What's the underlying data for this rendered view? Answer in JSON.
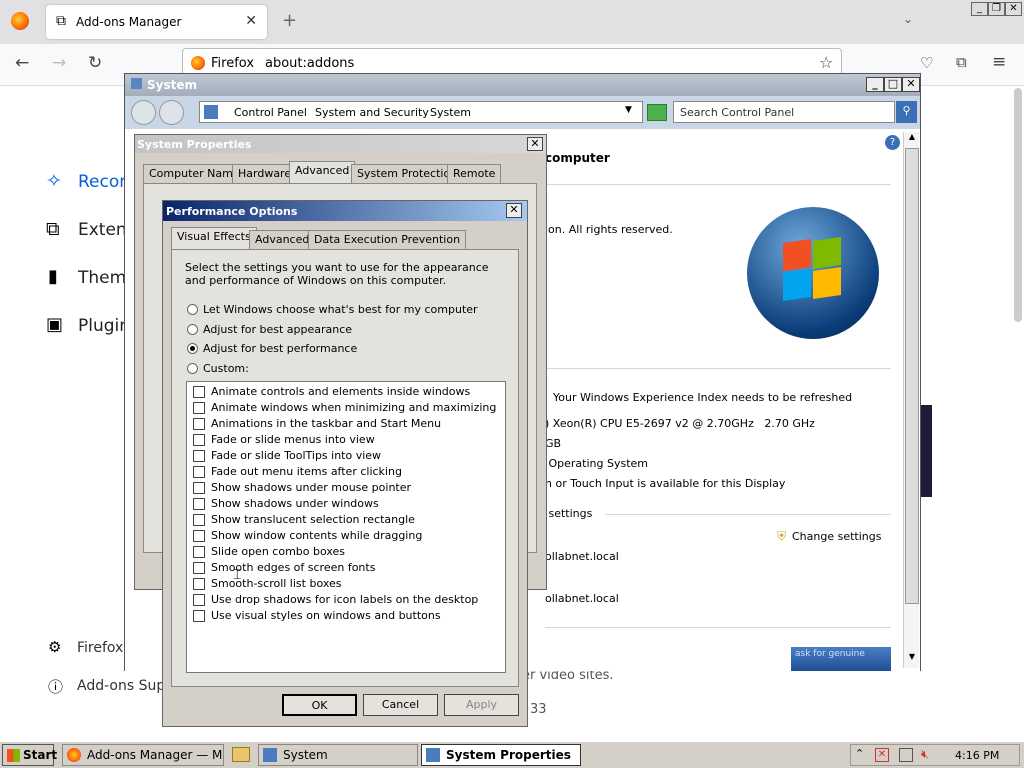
{
  "firefox": {
    "tab_title": "Add-ons Manager",
    "url_identity": "Firefox",
    "url": "about:addons"
  },
  "addons_page": {
    "sidebar": [
      {
        "label": "Recom",
        "icon": "sparkle-icon"
      },
      {
        "label": "Extens",
        "icon": "puzzle-icon"
      },
      {
        "label": "Theme",
        "icon": "brush-icon"
      },
      {
        "label": "Plugin",
        "icon": "plugin-icon"
      }
    ],
    "footer": [
      "Firefox",
      "Add-ons Supp"
    ],
    "bg_text": [
      "er video sites.",
      "33"
    ]
  },
  "system_window": {
    "title": "System",
    "breadcrumb": [
      "Control Panel",
      "System and Security",
      "System"
    ],
    "search_placeholder": "Search Control Panel",
    "heading_fragment": "computer",
    "rights": "ion.  All rights reserved.",
    "wei_text": "Your Windows Experience Index needs to be refreshed",
    "cpu": ") Xeon(R) CPU E5-2697 v2 @ 2.70GHz   2.70 GHz",
    "ram": "GB",
    "os_type": " Operating System",
    "pen": "n or Touch Input is available for this Display",
    "settings_section": " settings",
    "change_settings": "Change settings",
    "domain1": "ollabnet.local",
    "domain2": "ollabnet.local",
    "genuine": "ask for genuine"
  },
  "system_properties": {
    "title": "System Properties",
    "tabs": [
      "Computer Name",
      "Hardware",
      "Advanced",
      "System Protection",
      "Remote"
    ],
    "active_tab": "Advanced"
  },
  "performance_options": {
    "title": "Performance Options",
    "tabs": [
      "Visual Effects",
      "Advanced",
      "Data Execution Prevention"
    ],
    "description": "Select the settings you want to use for the appearance and performance of Windows on this computer.",
    "radios": [
      {
        "label": "Let Windows choose what's best for my computer",
        "checked": false
      },
      {
        "label": "Adjust for best appearance",
        "checked": false
      },
      {
        "label": "Adjust for best performance",
        "checked": true
      },
      {
        "label": "Custom:",
        "checked": false
      }
    ],
    "effects": [
      "Animate controls and elements inside windows",
      "Animate windows when minimizing and maximizing",
      "Animations in the taskbar and Start Menu",
      "Fade or slide menus into view",
      "Fade or slide ToolTips into view",
      "Fade out menu items after clicking",
      "Show shadows under mouse pointer",
      "Show shadows under windows",
      "Show translucent selection rectangle",
      "Show window contents while dragging",
      "Slide open combo boxes",
      "Smooth edges of screen fonts",
      "Smooth-scroll list boxes",
      "Use drop shadows for icon labels on the desktop",
      "Use visual styles on windows and buttons"
    ],
    "buttons": {
      "ok": "OK",
      "cancel": "Cancel",
      "apply": "Apply"
    }
  },
  "taskbar": {
    "start": "Start",
    "tasks": [
      "Add-ons Manager — Moz...",
      "System",
      "System Properties"
    ],
    "clock": "4:16 PM"
  },
  "colors": {
    "accent": "#0a246a",
    "ff_blue": "#0060df",
    "windows_orange": "#f25022"
  }
}
